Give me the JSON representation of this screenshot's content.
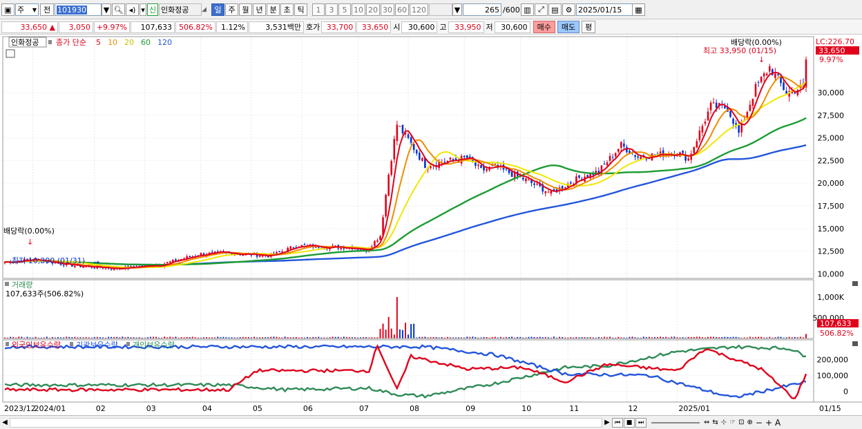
{
  "toolbar": {
    "period_type": "주",
    "prev_label": "전",
    "code": "101930",
    "new_badge": "신",
    "stock_name": "인화정공",
    "periods": [
      "일",
      "주",
      "월",
      "년",
      "분",
      "초",
      "틱"
    ],
    "active_period": "일",
    "intervals": [
      "1",
      "3",
      "5",
      "10",
      "20",
      "30",
      "60",
      "120"
    ],
    "count": "265",
    "count_total": "/600",
    "date": "2025/01/15"
  },
  "quote": {
    "price": "33,650",
    "arrow": "▲",
    "change": "3,050",
    "change_pct": "+9.97%",
    "volume": "107,633",
    "vol_ratio": "506.82%",
    "turnover": "1.12%",
    "amount": "3,531백만",
    "ask_label": "호가",
    "ask": "33,700",
    "bid": "33,650",
    "open_label": "시",
    "open": "30,600",
    "high_label": "고",
    "high": "33,950",
    "low_label": "저",
    "low": "30,600",
    "buy_label": "매수",
    "sell_label": "매도",
    "avg_label": "평"
  },
  "price_panel": {
    "name": "인화정공",
    "ma_title": "종가 단순",
    "ma_periods": [
      "5",
      "10",
      "20",
      "60",
      "120"
    ],
    "dividend_right": "배당락(0.00%)",
    "dividend_left": "배당락(0.00%)",
    "high_label": "최고 33,950 (01/15)",
    "low_label": "최저 10,300 (01/31)",
    "lc_label": "LC:226.70",
    "price_tag": "33,650",
    "pct_tag": "9.97%",
    "yticks": [
      "30,000",
      "27,500",
      "25,000",
      "22,500",
      "20,000",
      "17,500",
      "15,000",
      "12,500",
      "10,000"
    ]
  },
  "volume_panel": {
    "name": "거래량",
    "value_label": "107,633주(506.82%)",
    "yticks": [
      "1,000K",
      "500,000"
    ],
    "vol_tag": "107,633",
    "pct_tag": "506.82%"
  },
  "holding_panel": {
    "series_names": [
      "외국인보유수량",
      "기관보유수량",
      "개인보유수량"
    ],
    "yticks": [
      "200,000",
      "100,000",
      "0"
    ]
  },
  "xaxis": {
    "labels": [
      "2023/12",
      "2024/01",
      "02",
      "03",
      "04",
      "05",
      "06",
      "07",
      "08",
      "09",
      "10",
      "11",
      "12",
      "2025/01",
      "01/15"
    ]
  },
  "colors": {
    "up": "#e0001a",
    "down": "#0033cc",
    "ma5": "#e0001a",
    "ma10": "#f08c00",
    "ma20": "#f0e800",
    "ma60": "#1c9c32",
    "ma120": "#2255dd",
    "foreign": "#2255dd",
    "inst": "#e0001a",
    "indiv": "#2e8b57"
  },
  "chart_data": {
    "type": "candlestick",
    "unit": "KRW",
    "ylim": [
      9500,
      34500
    ],
    "anchors": [
      {
        "t": 0,
        "c": 11300
      },
      {
        "t": 10,
        "c": 11600
      },
      {
        "t": 25,
        "c": 10900
      },
      {
        "t": 40,
        "c": 10600
      },
      {
        "t": 55,
        "c": 11000
      },
      {
        "t": 70,
        "c": 12200
      },
      {
        "t": 80,
        "c": 12300
      },
      {
        "t": 95,
        "c": 12000
      },
      {
        "t": 104,
        "c": 13100
      },
      {
        "t": 125,
        "c": 12900
      },
      {
        "t": 129,
        "c": 12600
      },
      {
        "t": 134,
        "c": 14200
      },
      {
        "t": 137,
        "c": 21000
      },
      {
        "t": 140,
        "c": 26500
      },
      {
        "t": 144,
        "c": 24800
      },
      {
        "t": 150,
        "c": 22000
      },
      {
        "t": 165,
        "c": 22800
      },
      {
        "t": 170,
        "c": 21400
      },
      {
        "t": 175,
        "c": 21800
      },
      {
        "t": 185,
        "c": 20500
      },
      {
        "t": 195,
        "c": 18900
      },
      {
        "t": 205,
        "c": 20600
      },
      {
        "t": 212,
        "c": 21300
      },
      {
        "t": 220,
        "c": 24200
      },
      {
        "t": 226,
        "c": 22900
      },
      {
        "t": 240,
        "c": 23400
      },
      {
        "t": 244,
        "c": 22700
      },
      {
        "t": 252,
        "c": 28500
      },
      {
        "t": 258,
        "c": 28300
      },
      {
        "t": 262,
        "c": 25500
      },
      {
        "t": 268,
        "c": 30500
      },
      {
        "t": 273,
        "c": 32800
      },
      {
        "t": 279,
        "c": 30000
      },
      {
        "t": 285,
        "c": 30600
      },
      {
        "t": 286,
        "c": 33650
      }
    ],
    "ma_values": [
      {
        "name": "5",
        "start": 11200,
        "end": 31000
      },
      {
        "name": "10",
        "start": 11150,
        "end": 30800
      },
      {
        "name": "20",
        "start": 11100,
        "end": 30500
      },
      {
        "name": "60",
        "start": 10600,
        "end": 27100
      },
      {
        "name": "120",
        "start": 10500,
        "end": 24200
      }
    ],
    "volume": {
      "ylim": [
        0,
        1150000
      ],
      "peak": 1000000,
      "peak_t": 140,
      "last": 107633
    },
    "holdings": {
      "ylim": [
        -50000,
        280000
      ],
      "foreign": [
        [
          0,
          280000
        ],
        [
          150,
          280000
        ],
        [
          175,
          230000
        ],
        [
          200,
          110000
        ],
        [
          230,
          100000
        ],
        [
          260,
          -40000
        ],
        [
          286,
          60000
        ]
      ],
      "institution": [
        [
          0,
          10000
        ],
        [
          80,
          10000
        ],
        [
          90,
          130000
        ],
        [
          130,
          130000
        ],
        [
          133,
          290000
        ],
        [
          140,
          10000
        ],
        [
          145,
          220000
        ],
        [
          165,
          140000
        ],
        [
          185,
          150000
        ],
        [
          200,
          60000
        ],
        [
          215,
          170000
        ],
        [
          240,
          130000
        ],
        [
          250,
          270000
        ],
        [
          270,
          140000
        ],
        [
          282,
          -50000
        ],
        [
          286,
          110000
        ]
      ],
      "individual": [
        [
          0,
          40000
        ],
        [
          80,
          40000
        ],
        [
          100,
          10000
        ],
        [
          130,
          20000
        ],
        [
          140,
          -20000
        ],
        [
          150,
          -30000
        ],
        [
          175,
          50000
        ],
        [
          200,
          150000
        ],
        [
          215,
          160000
        ],
        [
          240,
          250000
        ],
        [
          260,
          280000
        ],
        [
          280,
          270000
        ],
        [
          286,
          220000
        ]
      ]
    },
    "highest": {
      "value": 33950,
      "date": "01/15"
    },
    "lowest": {
      "value": 10300,
      "date": "01/31"
    }
  }
}
